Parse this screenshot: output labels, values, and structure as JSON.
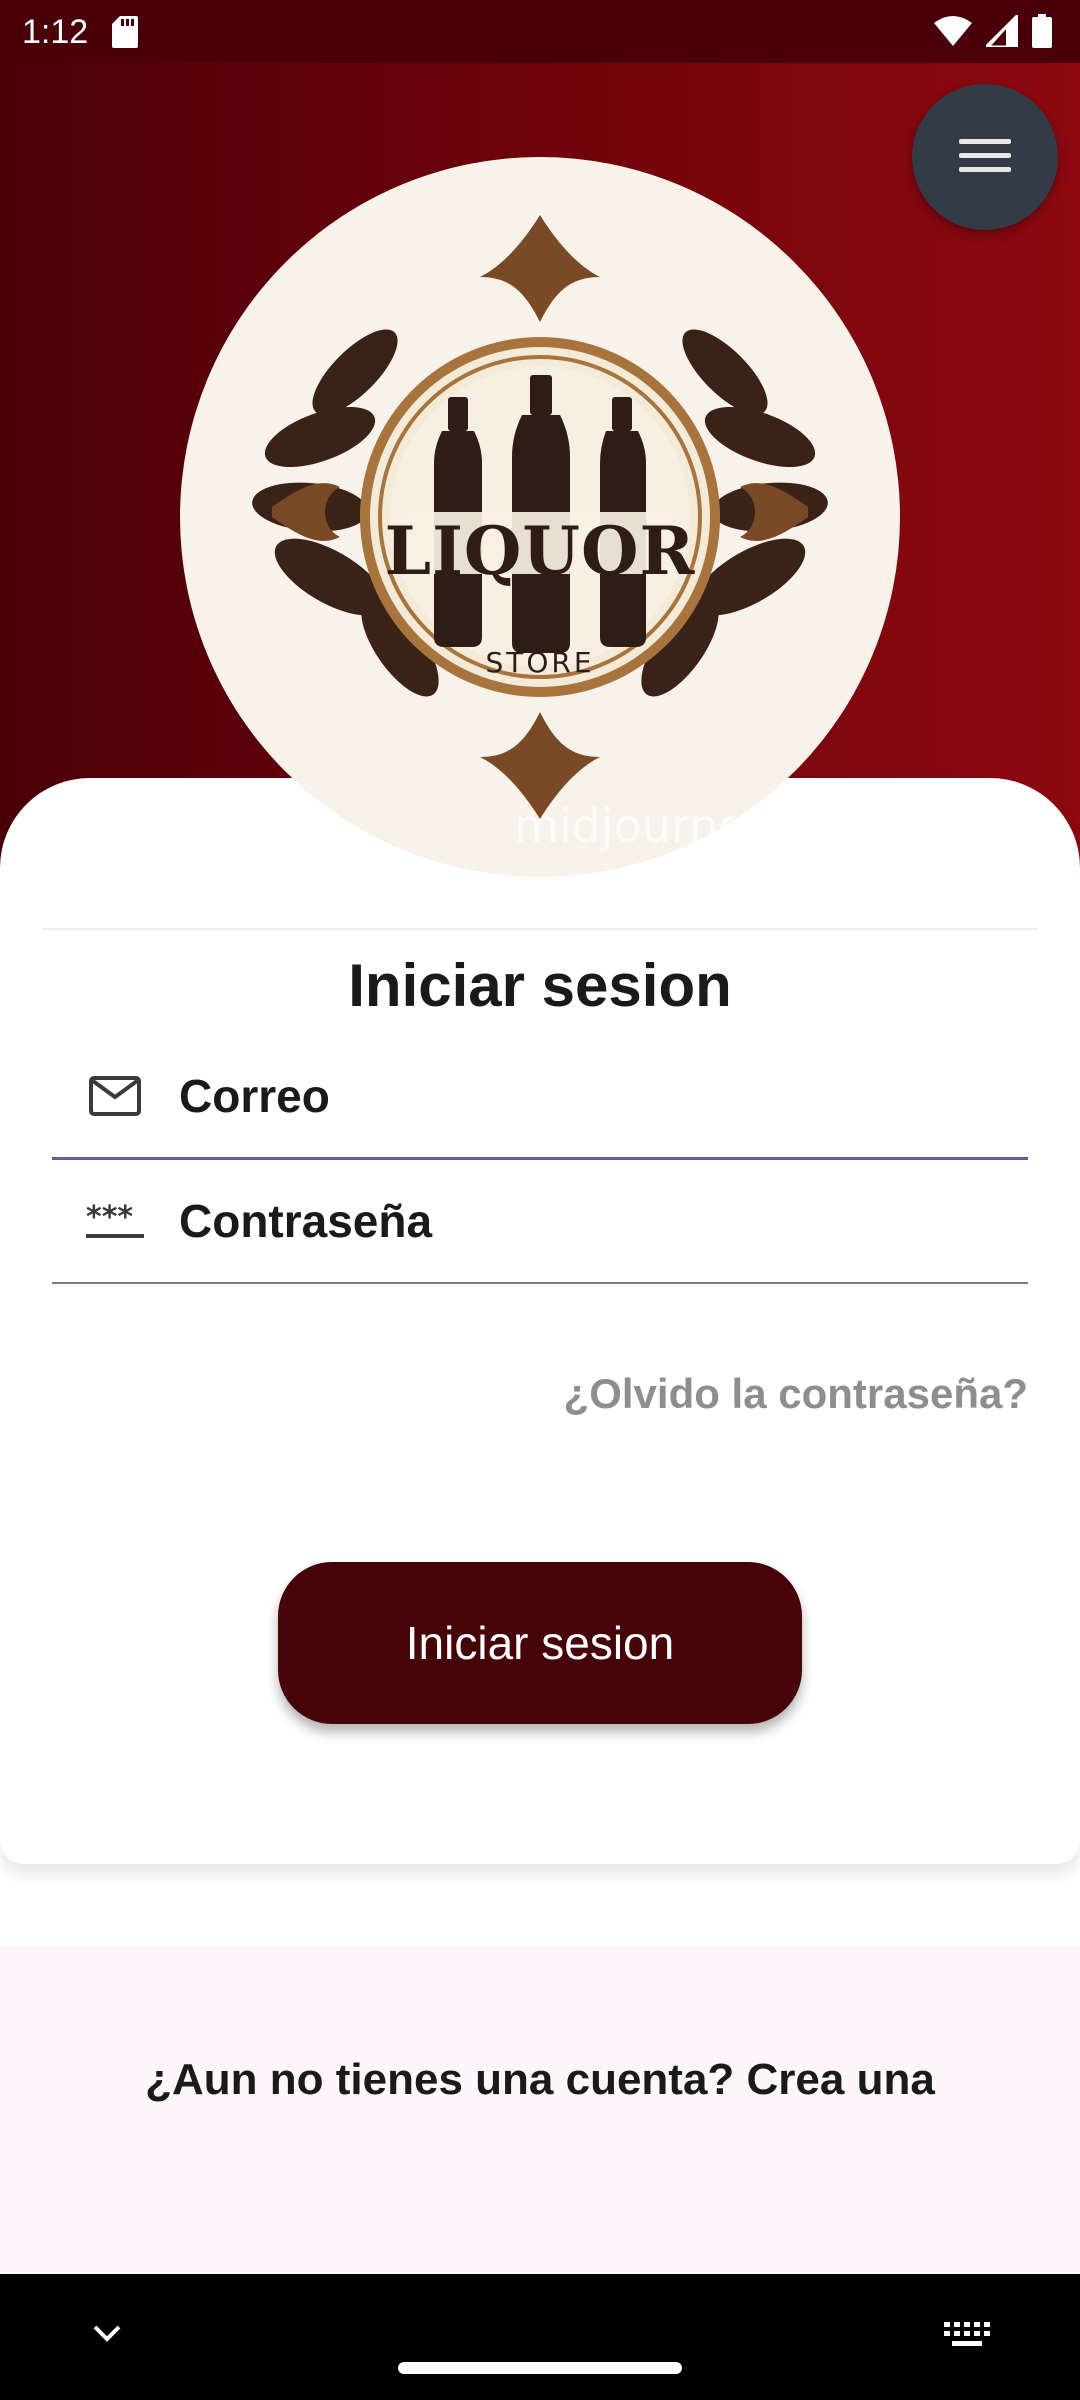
{
  "status_bar": {
    "time": "1:12",
    "icons": [
      "sd-card-icon",
      "wifi-icon",
      "signal-icon",
      "battery-icon"
    ]
  },
  "header": {
    "menu_icon": "hamburger-menu-icon",
    "logo": {
      "name": "LIQUOR",
      "tagline": "STORE",
      "watermark": "midjourney"
    }
  },
  "login": {
    "title": "Iniciar sesion",
    "email": {
      "placeholder": "Correo",
      "value": "",
      "icon": "mail-icon"
    },
    "password": {
      "placeholder": "Contraseña",
      "value": "",
      "icon": "password-dots-icon"
    },
    "forgot_label": "¿Olvido la contraseña?",
    "submit_label": "Iniciar sesion"
  },
  "signup": {
    "label": "¿Aun no tienes una cuenta? Crea una"
  },
  "nav_bar": {
    "icons": [
      "chevron-down-icon",
      "home-handle",
      "keyboard-icon"
    ]
  },
  "colors": {
    "hero_gradient_start": "#4a0008",
    "hero_gradient_end": "#8e0910",
    "menu_button": "#323b46",
    "primary_button": "#460308",
    "focused_underline": "#6b5a9b",
    "muted_link": "#8e8e8e",
    "signup_background": "#fdf7fc"
  }
}
